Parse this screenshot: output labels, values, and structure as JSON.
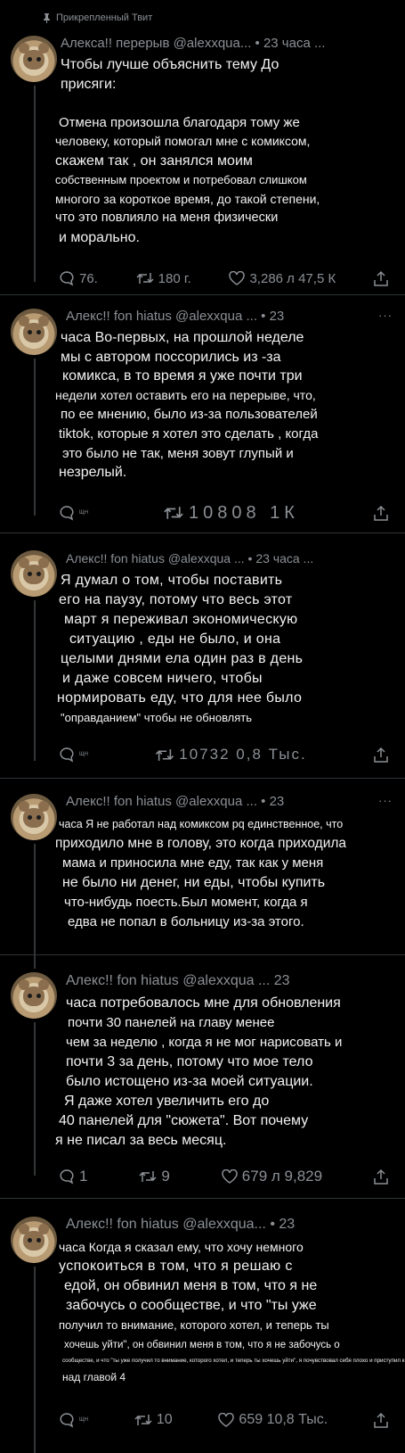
{
  "pinned_label": "Прикрепленный Твит",
  "tweets": [
    {
      "header": "Алекса!! перерыв @alexxqua... • 23 часа ...",
      "lines": [
        "Чтобы лучше объяснить тему До",
        "присяги:",
        "",
        "Отмена произошла благодаря тому же",
        "человеку, который помогал мне с комиксом,",
        "скажем так , он занялся моим",
        "собственным проектом и потребовал слишком",
        "многого за короткое время, до такой степени,",
        "что это повлияло на меня физически",
        "и морально."
      ],
      "replies": "76.",
      "retweets": "180 г.",
      "likes": "3,286 л 47,5 К"
    },
    {
      "header": "Алекс!! fon hiatus @alexxqua ... • 23",
      "lines": [
        "часа Во-первых, на прошлой неделе",
        "мы с автором поссорились из -за",
        "комикса, в то время я уже почти три",
        "недели хотел оставить его на перерыве, что,",
        "по ее мнению, было из-за пользователей",
        "tiktok, которые я хотел это сделать , когда",
        "это было не так, меня зовут глупый и",
        "незрелый."
      ],
      "replies": "ЩН",
      "retweets": "10808 1К",
      "likes": ""
    },
    {
      "header": "Алекс!! fon hiatus @alexxqua ... • 23 часа ...",
      "lines": [
        "Я думал о том, чтобы поставить",
        "его на паузу, потому что весь этот",
        "март я переживал экономическую",
        "ситуацию , еды не было, и она",
        "целыми днями ела один раз в день",
        "и даже совсем ничего, чтобы",
        "нормировать еду, что для нее было",
        "\"оправданием\" чтобы не обновлять"
      ],
      "replies": "ЩН",
      "retweets": "10732 0,8 Тыс.",
      "likes": ""
    },
    {
      "header": "Алекс!! fon hiatus @alexxqua ... • 23",
      "lines": [
        "часа Я не работал над комиксом pq единственное, что",
        "приходило мне в голову, это когда приходила",
        "мама и приносила мне еду, так как у меня",
        "не было ни денег, ни еды, чтобы купить",
        "что-нибудь поесть.Был момент, когда я",
        "едва не попал в больницу из-за этого."
      ],
      "replies": "",
      "retweets": "",
      "likes": ""
    },
    {
      "header": "Алекс!! fon hiatus @alexxqua ... 23",
      "lines": [
        "часа потребовалось мне для обновления",
        "почти 30 панелей на главу менее",
        "чем за неделю , когда я не мог нарисовать и",
        "почти 3 за день, потому что мое тело",
        "было истощено из-за моей ситуации.",
        "Я даже хотел увеличить его до",
        "40 панелей для \"сюжета\". Вот почему",
        "я не писал за весь месяц."
      ],
      "replies": "1",
      "retweets": "9",
      "likes": "679 л 9,829"
    },
    {
      "header": "Алекс!! fon hiatus @alexxqua... • 23",
      "lines": [
        "часа Когда я сказал ему, что хочу немного",
        "успокоиться в том, что я решаю с",
        "едой, он обвинил меня в том, что я не",
        "забочусь о сообществе, и что \"ты уже",
        "получил то внимание, которого хотел, и теперь ты",
        "хочешь уйти\", он обвинил меня в том, что я не забочусь о",
        "сообществе, и что \"ты уже получил то внимание, которого хотел, и теперь ты хочешь уйти\", я почувствовал себя плохо и приступил к работе",
        "над главой 4"
      ],
      "replies": "ЩН",
      "retweets": "10",
      "likes": "659 10,8 Тыс."
    }
  ]
}
